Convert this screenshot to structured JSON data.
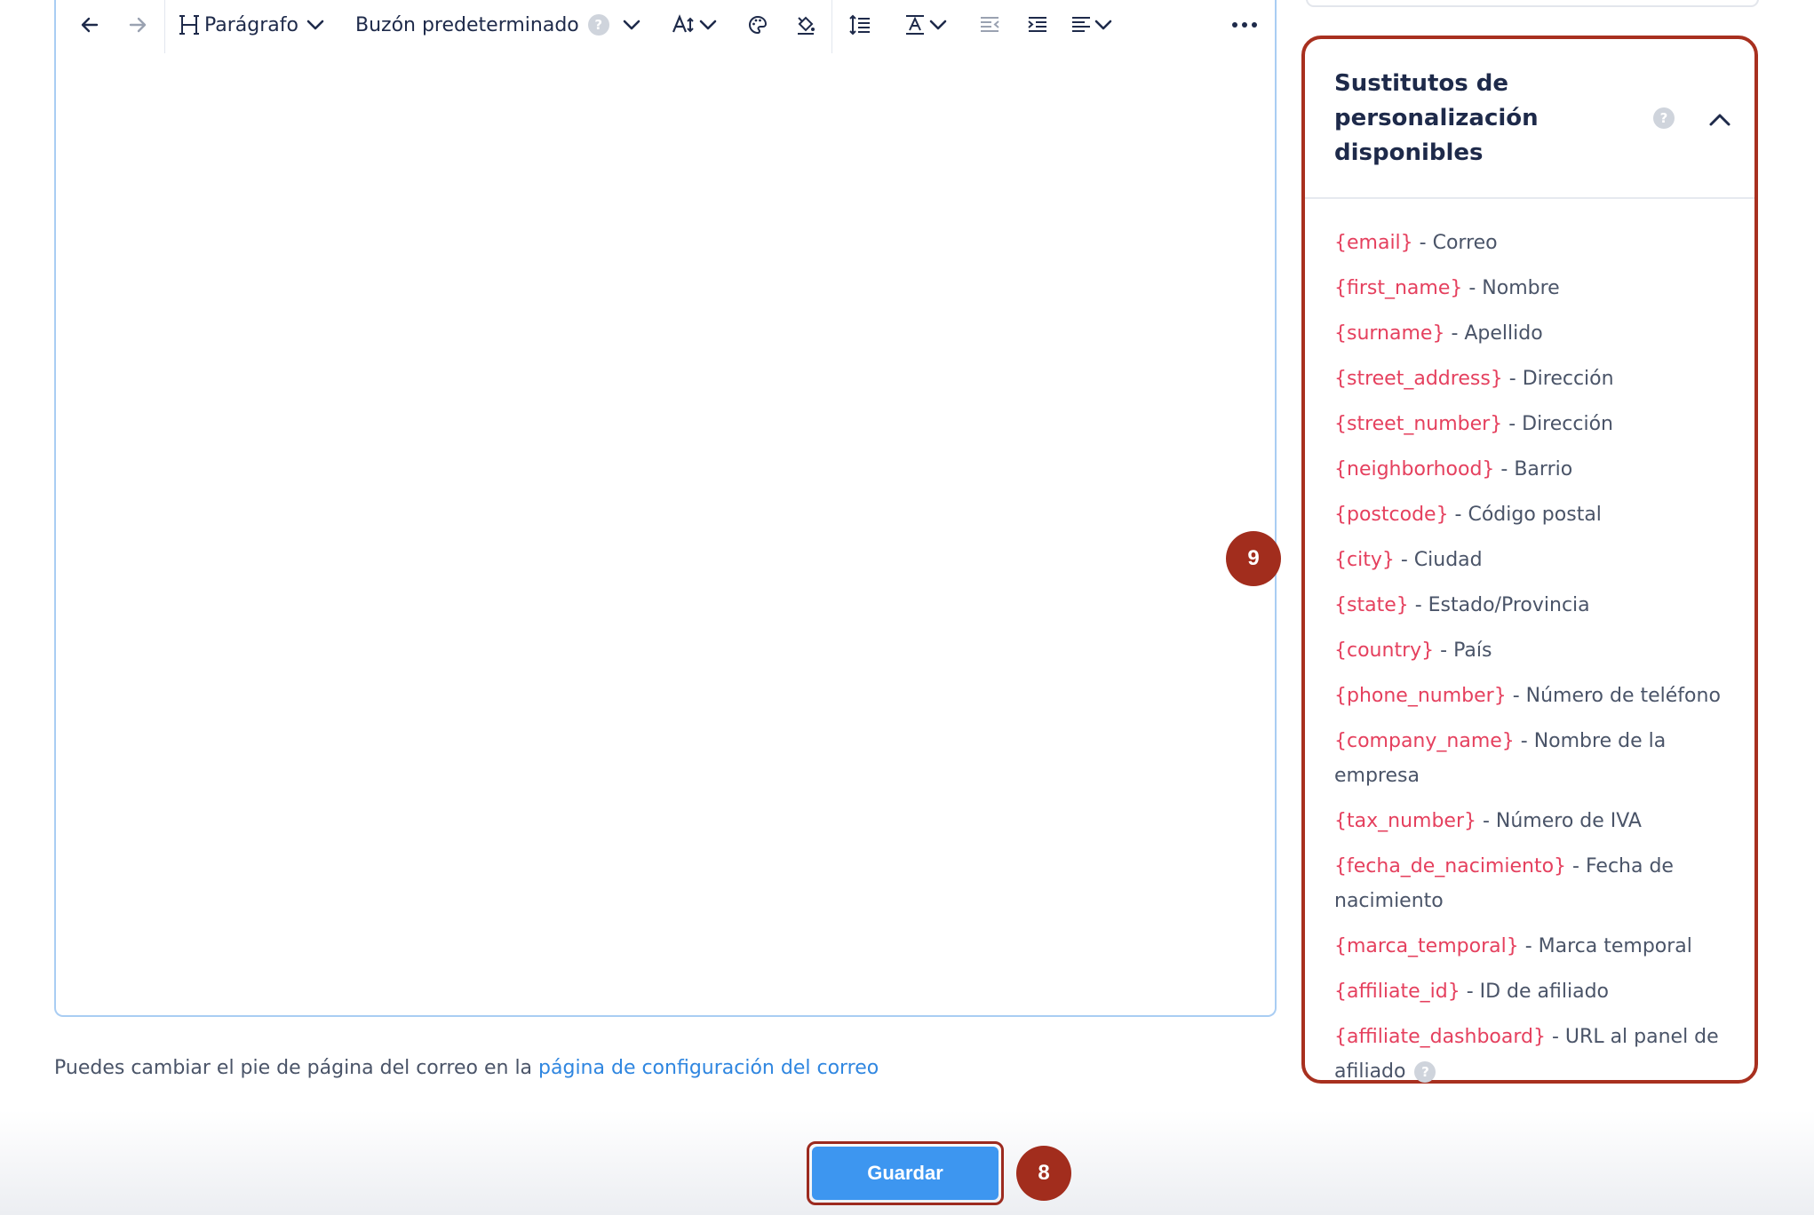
{
  "toolbar": {
    "block_style_label": "Parágrafo",
    "mailbox_label": "Buzón predeterminado",
    "help_mark": "?"
  },
  "footer_note": {
    "text": "Puedes cambiar el pie de página del correo en la ",
    "link": "página de configuración del correo"
  },
  "save_button": {
    "label": "Guardar"
  },
  "badges": {
    "save_step": "8",
    "panel_step": "9"
  },
  "placeholders_panel": {
    "title": "Sustitutos de personalización disponibles",
    "help_mark": "?",
    "items": [
      {
        "token": "{email}",
        "desc": " - Correo"
      },
      {
        "token": "{first_name}",
        "desc": " - Nombre"
      },
      {
        "token": "{surname}",
        "desc": " - Apellido"
      },
      {
        "token": "{street_address}",
        "desc": " - Dirección"
      },
      {
        "token": "{street_number}",
        "desc": " - Dirección"
      },
      {
        "token": "{neighborhood}",
        "desc": " - Barrio"
      },
      {
        "token": "{postcode}",
        "desc": " - Código postal"
      },
      {
        "token": "{city}",
        "desc": " - Ciudad"
      },
      {
        "token": "{state}",
        "desc": " - Estado/Provincia"
      },
      {
        "token": "{country}",
        "desc": " - País"
      },
      {
        "token": "{phone_number}",
        "desc": " - Número de teléfono"
      },
      {
        "token": "{company_name}",
        "desc": " - Nombre de la empresa"
      },
      {
        "token": "{tax_number}",
        "desc": " - Número de IVA"
      },
      {
        "token": "{fecha_de_nacimiento}",
        "desc": " - Fecha de nacimiento"
      },
      {
        "token": "{marca_temporal}",
        "desc": " - Marca temporal"
      },
      {
        "token": "{affiliate_id}",
        "desc": " - ID de afiliado"
      },
      {
        "token": "{affiliate_dashboard}",
        "desc": " - URL al panel de afiliado",
        "help": "?"
      }
    ]
  },
  "colors": {
    "accent_blue": "#3d96f0",
    "annotation_red": "#a22d1d",
    "token_pink": "#e5405e"
  }
}
